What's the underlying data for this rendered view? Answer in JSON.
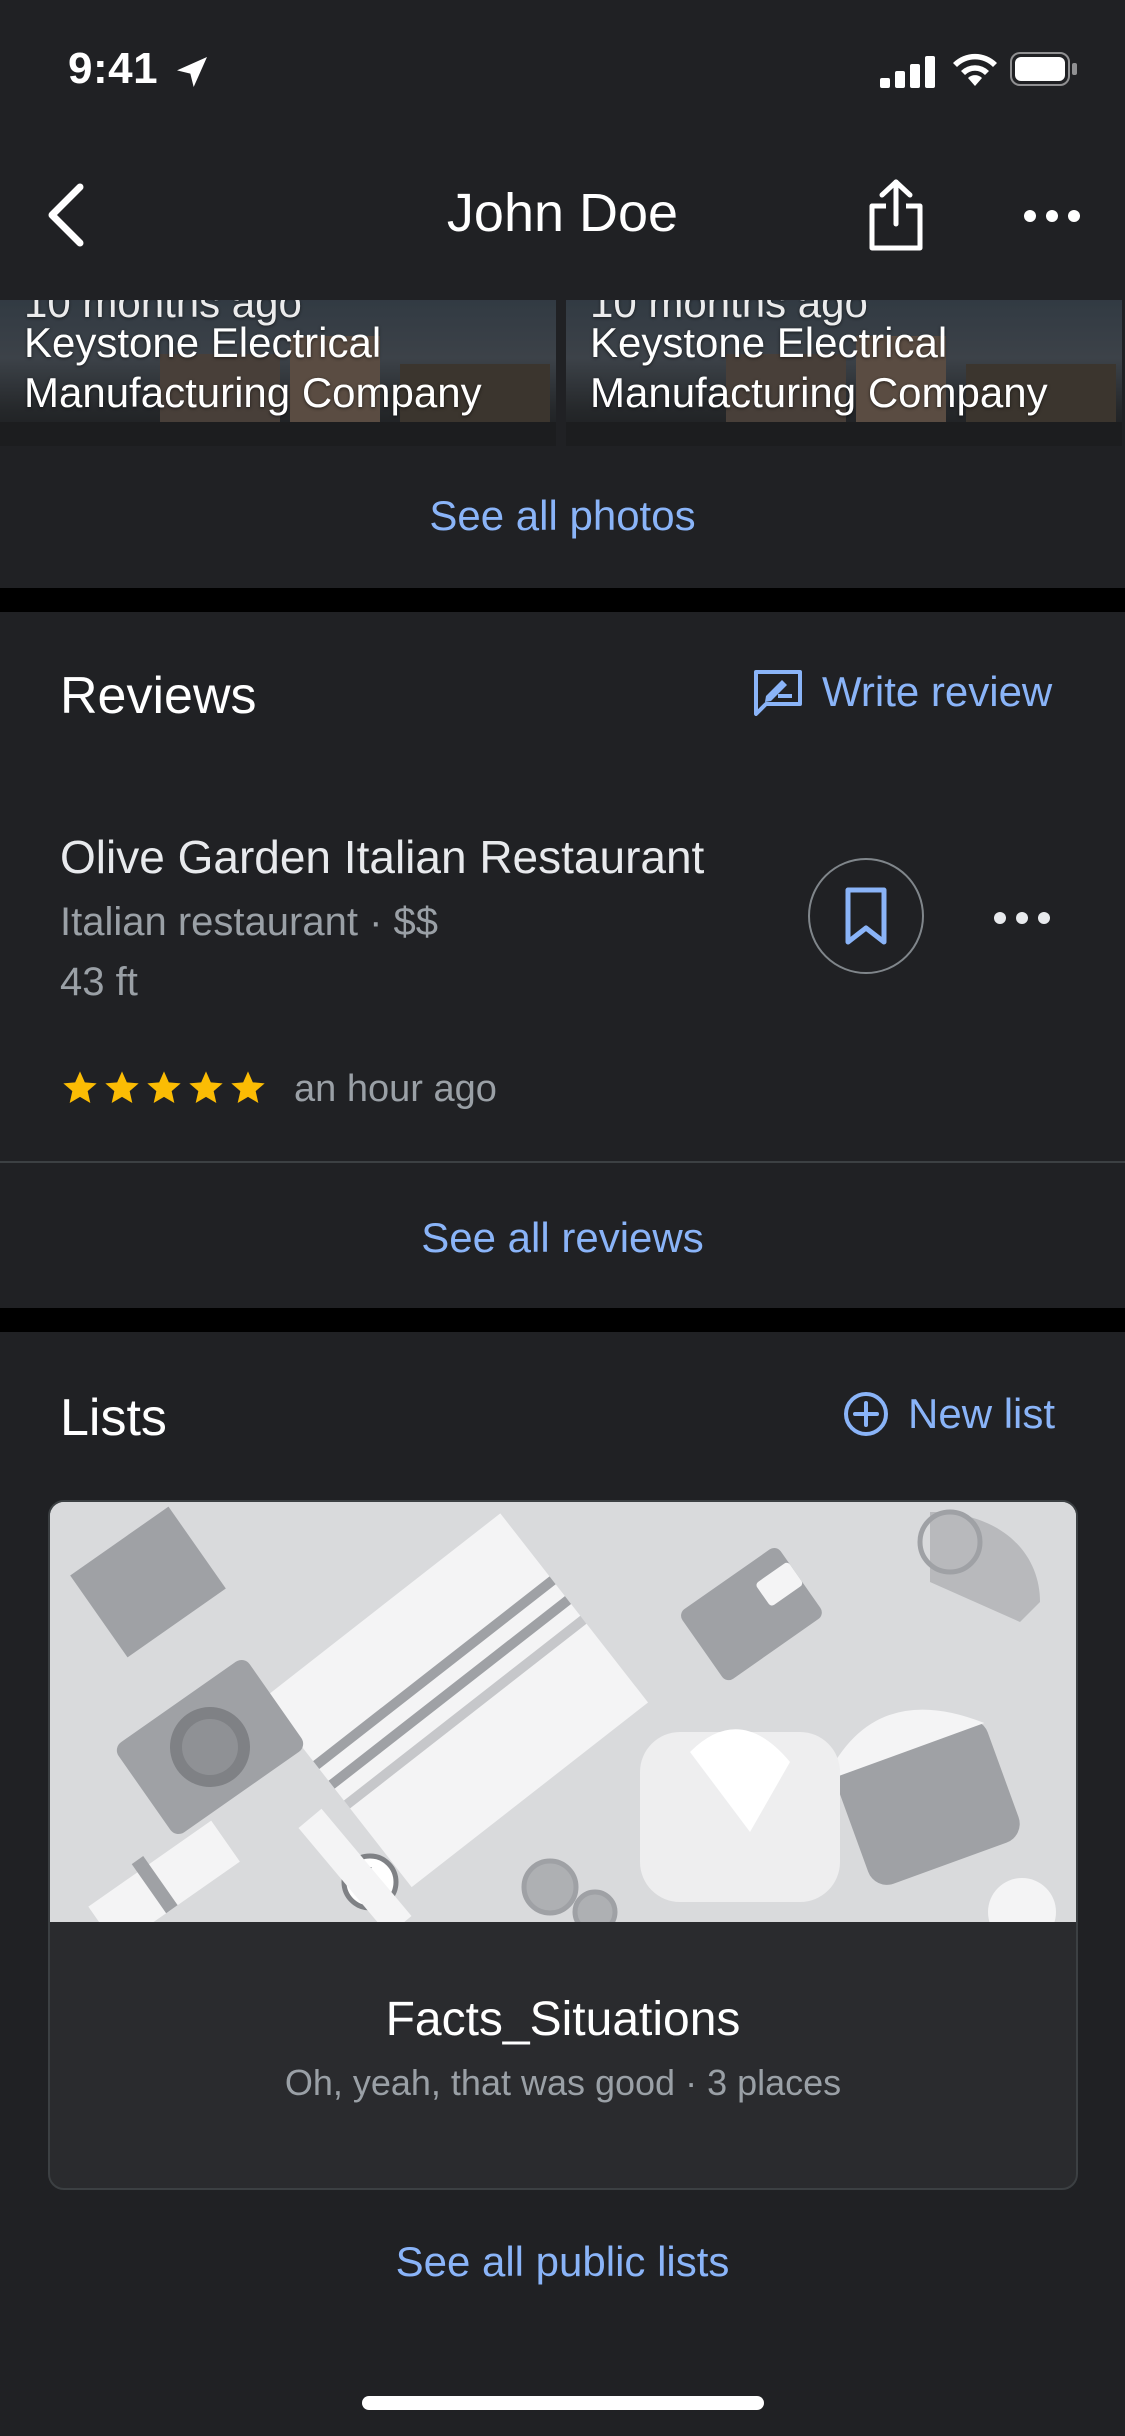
{
  "status_bar": {
    "time": "9:41"
  },
  "nav": {
    "title": "John Doe"
  },
  "photos": {
    "items": [
      {
        "date": "10 months ago",
        "caption_line1": "Keystone Electrical",
        "caption_line2": "Manufacturing Company"
      },
      {
        "date": "10 months ago",
        "caption_line1": "Keystone Electrical",
        "caption_line2": "Manufacturing Company"
      }
    ],
    "see_all": "See all photos"
  },
  "reviews": {
    "title": "Reviews",
    "write_label": "Write review",
    "item": {
      "place": "Olive Garden Italian Restaurant",
      "category": "Italian restaurant · $$",
      "distance": "43 ft",
      "rating": 5,
      "time": "an hour ago"
    },
    "see_all": "See all reviews"
  },
  "lists": {
    "title": "Lists",
    "new_label": "New list",
    "card": {
      "name": "Facts_Situations",
      "subtitle": "Oh, yeah, that was good · 3 places"
    },
    "see_all": "See all public lists"
  },
  "colors": {
    "background": "#202124",
    "accent": "#8ab4f8",
    "star": "#fbbc04",
    "secondary_text": "#9aa0a6"
  },
  "icons": [
    "location-arrow-icon",
    "signal-icon",
    "wifi-icon",
    "battery-icon",
    "back-icon",
    "share-icon",
    "more-icon",
    "write-review-icon",
    "bookmark-icon",
    "star-icon",
    "add-circle-icon"
  ]
}
